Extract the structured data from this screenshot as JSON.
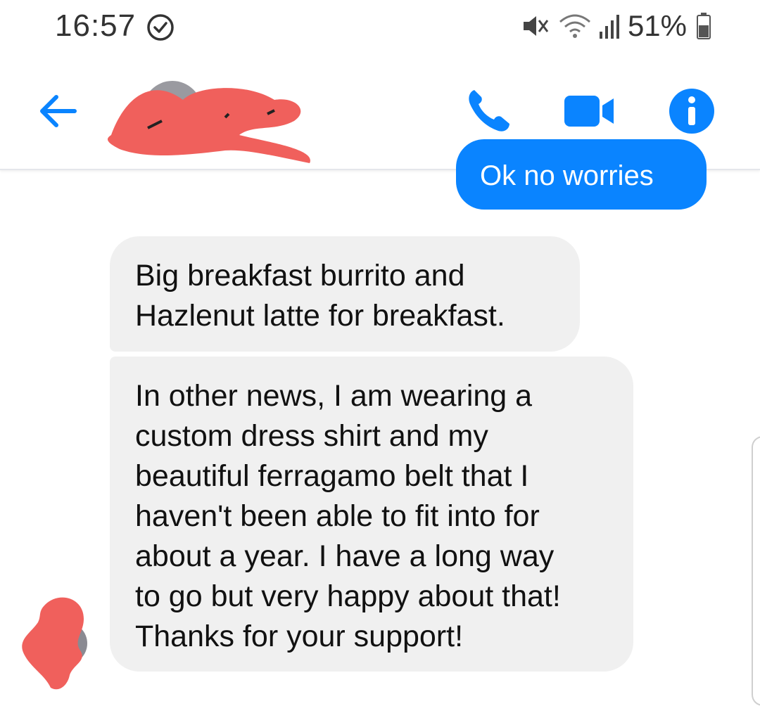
{
  "status_bar": {
    "time": "16:57",
    "battery": "51%"
  },
  "header": {
    "back_icon": "arrow-left-icon",
    "call_icon": "phone-icon",
    "video_icon": "video-camera-icon",
    "info_icon": "info-icon"
  },
  "messages": {
    "sent_preview": "Ok no worries",
    "received": [
      {
        "lines": [
          "Big breakfast burrito and",
          "Hazlenut latte for breakfast."
        ]
      },
      {
        "lines": [
          "In other news, I am wearing a",
          "custom dress shirt and my",
          "beautiful ferragamo belt that I",
          "haven't been able to fit into for",
          "about a year. I have a long way",
          "to go but very happy about that!",
          "Thanks for your support!"
        ]
      }
    ]
  },
  "colors": {
    "accent": "#0a84ff",
    "bubble_received": "#f0f0f0",
    "redaction": "#f0605c"
  }
}
